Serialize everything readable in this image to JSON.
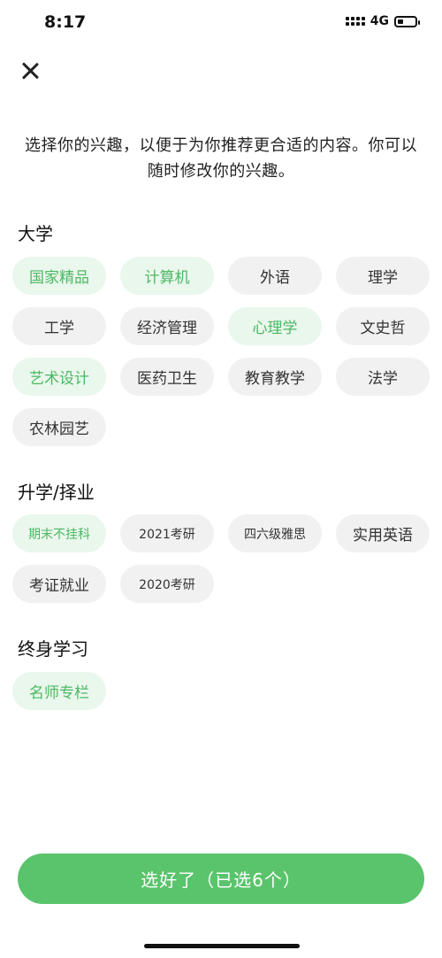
{
  "status_bar": {
    "time": "8:17",
    "network": "4G"
  },
  "intro": "选择你的兴趣，以便于为你推荐更合适的内容。你可以随时修改你的兴趣。",
  "sections": [
    {
      "title": "大学",
      "chips": [
        {
          "label": "国家精品",
          "selected": true
        },
        {
          "label": "计算机",
          "selected": true
        },
        {
          "label": "外语",
          "selected": false
        },
        {
          "label": "理学",
          "selected": false
        },
        {
          "label": "工学",
          "selected": false
        },
        {
          "label": "经济管理",
          "selected": false
        },
        {
          "label": "心理学",
          "selected": true
        },
        {
          "label": "文史哲",
          "selected": false
        },
        {
          "label": "艺术设计",
          "selected": true
        },
        {
          "label": "医药卫生",
          "selected": false
        },
        {
          "label": "教育教学",
          "selected": false
        },
        {
          "label": "法学",
          "selected": false
        },
        {
          "label": "农林园艺",
          "selected": false
        }
      ]
    },
    {
      "title": "升学/择业",
      "chips": [
        {
          "label": "期末不挂科",
          "selected": true
        },
        {
          "label": "2021考研",
          "selected": false
        },
        {
          "label": "四六级雅思",
          "selected": false
        },
        {
          "label": "实用英语",
          "selected": false
        },
        {
          "label": "考证就业",
          "selected": false
        },
        {
          "label": "2020考研",
          "selected": false
        }
      ]
    },
    {
      "title": "终身学习",
      "chips": [
        {
          "label": "名师专栏",
          "selected": true
        }
      ]
    }
  ],
  "confirm_button": "选好了（已选6个）",
  "colors": {
    "accent": "#5ac46c",
    "selected_text": "#4cb863",
    "selected_bg": "#e9f7ec",
    "chip_bg": "#f1f1f1"
  }
}
